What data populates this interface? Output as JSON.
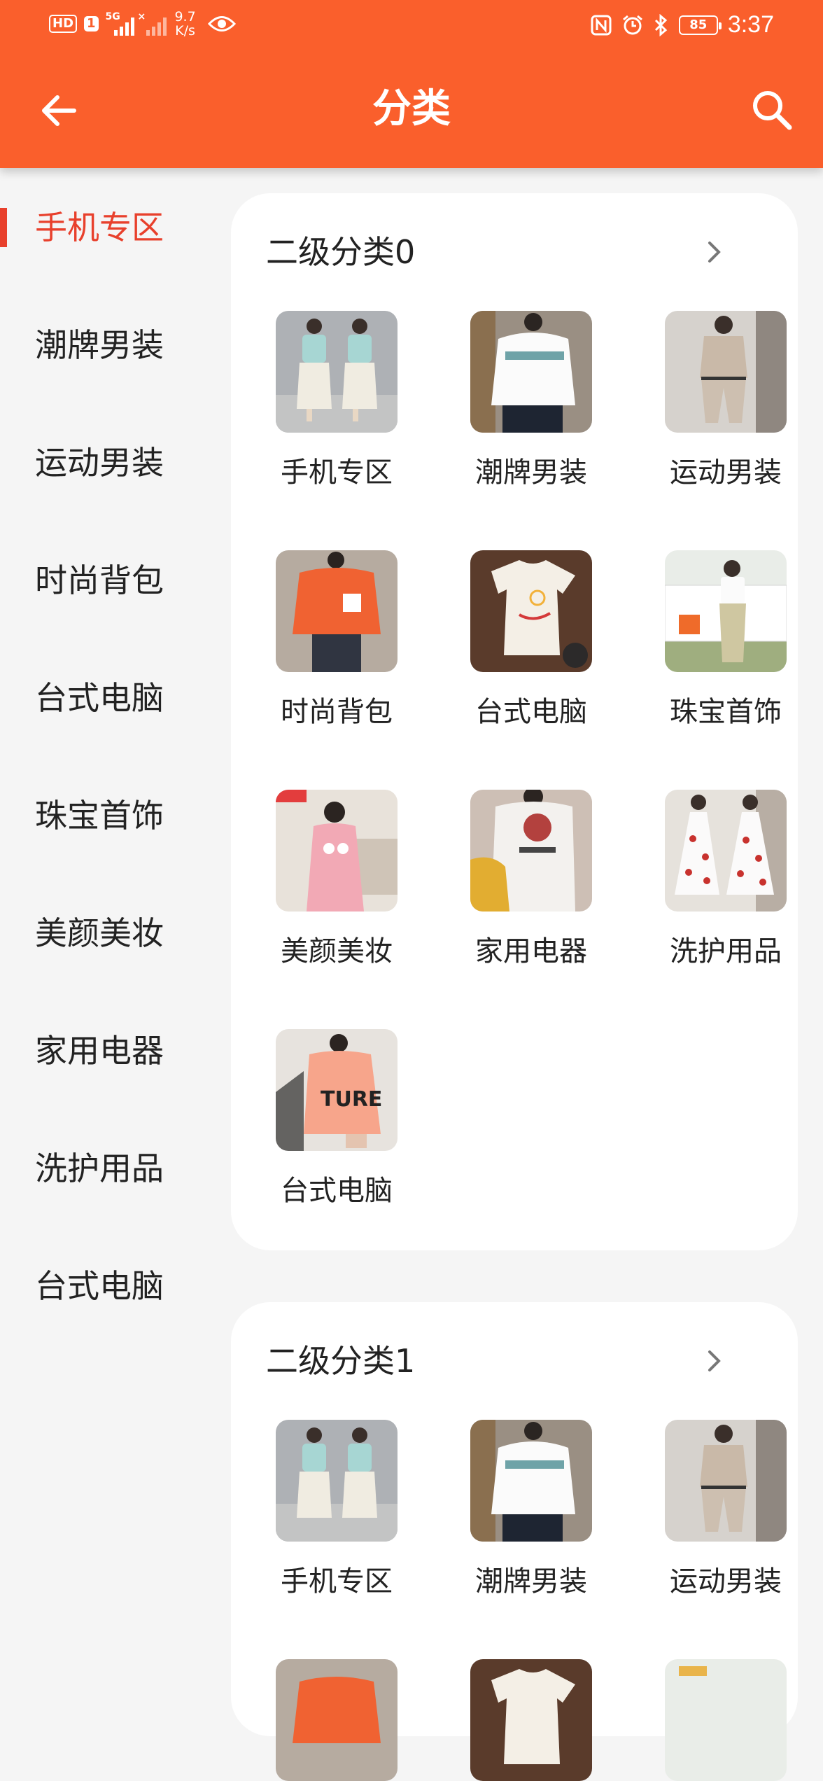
{
  "status_bar": {
    "hd_label": "HD",
    "sim_label": "1",
    "net_label": "5G",
    "net_speed_value": "9.7",
    "net_speed_unit": "K/s",
    "battery_level": "85",
    "time": "3:37"
  },
  "header": {
    "title": "分类",
    "icons": [
      "arrow-back-icon",
      "search-icon"
    ],
    "color": "#fa5f2c"
  },
  "sidebar": {
    "active_index": 0,
    "active_color": "#e8402c",
    "items": [
      {
        "label": "手机专区"
      },
      {
        "label": "潮牌男装"
      },
      {
        "label": "运动男装"
      },
      {
        "label": "时尚背包"
      },
      {
        "label": "台式电脑"
      },
      {
        "label": "珠宝首饰"
      },
      {
        "label": "美颜美妆"
      },
      {
        "label": "家用电器"
      },
      {
        "label": "洗护用品"
      },
      {
        "label": "台式电脑"
      }
    ]
  },
  "sections": [
    {
      "title": "二级分类0",
      "items": [
        {
          "label": "手机专区",
          "image": "two-women-teal-top-skirt"
        },
        {
          "label": "潮牌男装",
          "image": "man-white-sweatshirt"
        },
        {
          "label": "运动男装",
          "image": "man-beige-tracksuit"
        },
        {
          "label": "时尚背包",
          "image": "orange-tshirt"
        },
        {
          "label": "台式电脑",
          "image": "white-tshirt-flatlay"
        },
        {
          "label": "珠宝首饰",
          "image": "woman-outdoor-white-top"
        },
        {
          "label": "美颜美妆",
          "image": "woman-pink-dress"
        },
        {
          "label": "家用电器",
          "image": "woman-white-printed-tee"
        },
        {
          "label": "洗护用品",
          "image": "polka-dot-dresses"
        },
        {
          "label": "台式电脑",
          "image": "orange-printed-tee-dress"
        }
      ]
    },
    {
      "title": "二级分类1",
      "items": [
        {
          "label": "手机专区",
          "image": "two-women-teal-top-skirt"
        },
        {
          "label": "潮牌男装",
          "image": "man-white-sweatshirt"
        },
        {
          "label": "运动男装",
          "image": "man-beige-tracksuit"
        }
      ]
    }
  ]
}
